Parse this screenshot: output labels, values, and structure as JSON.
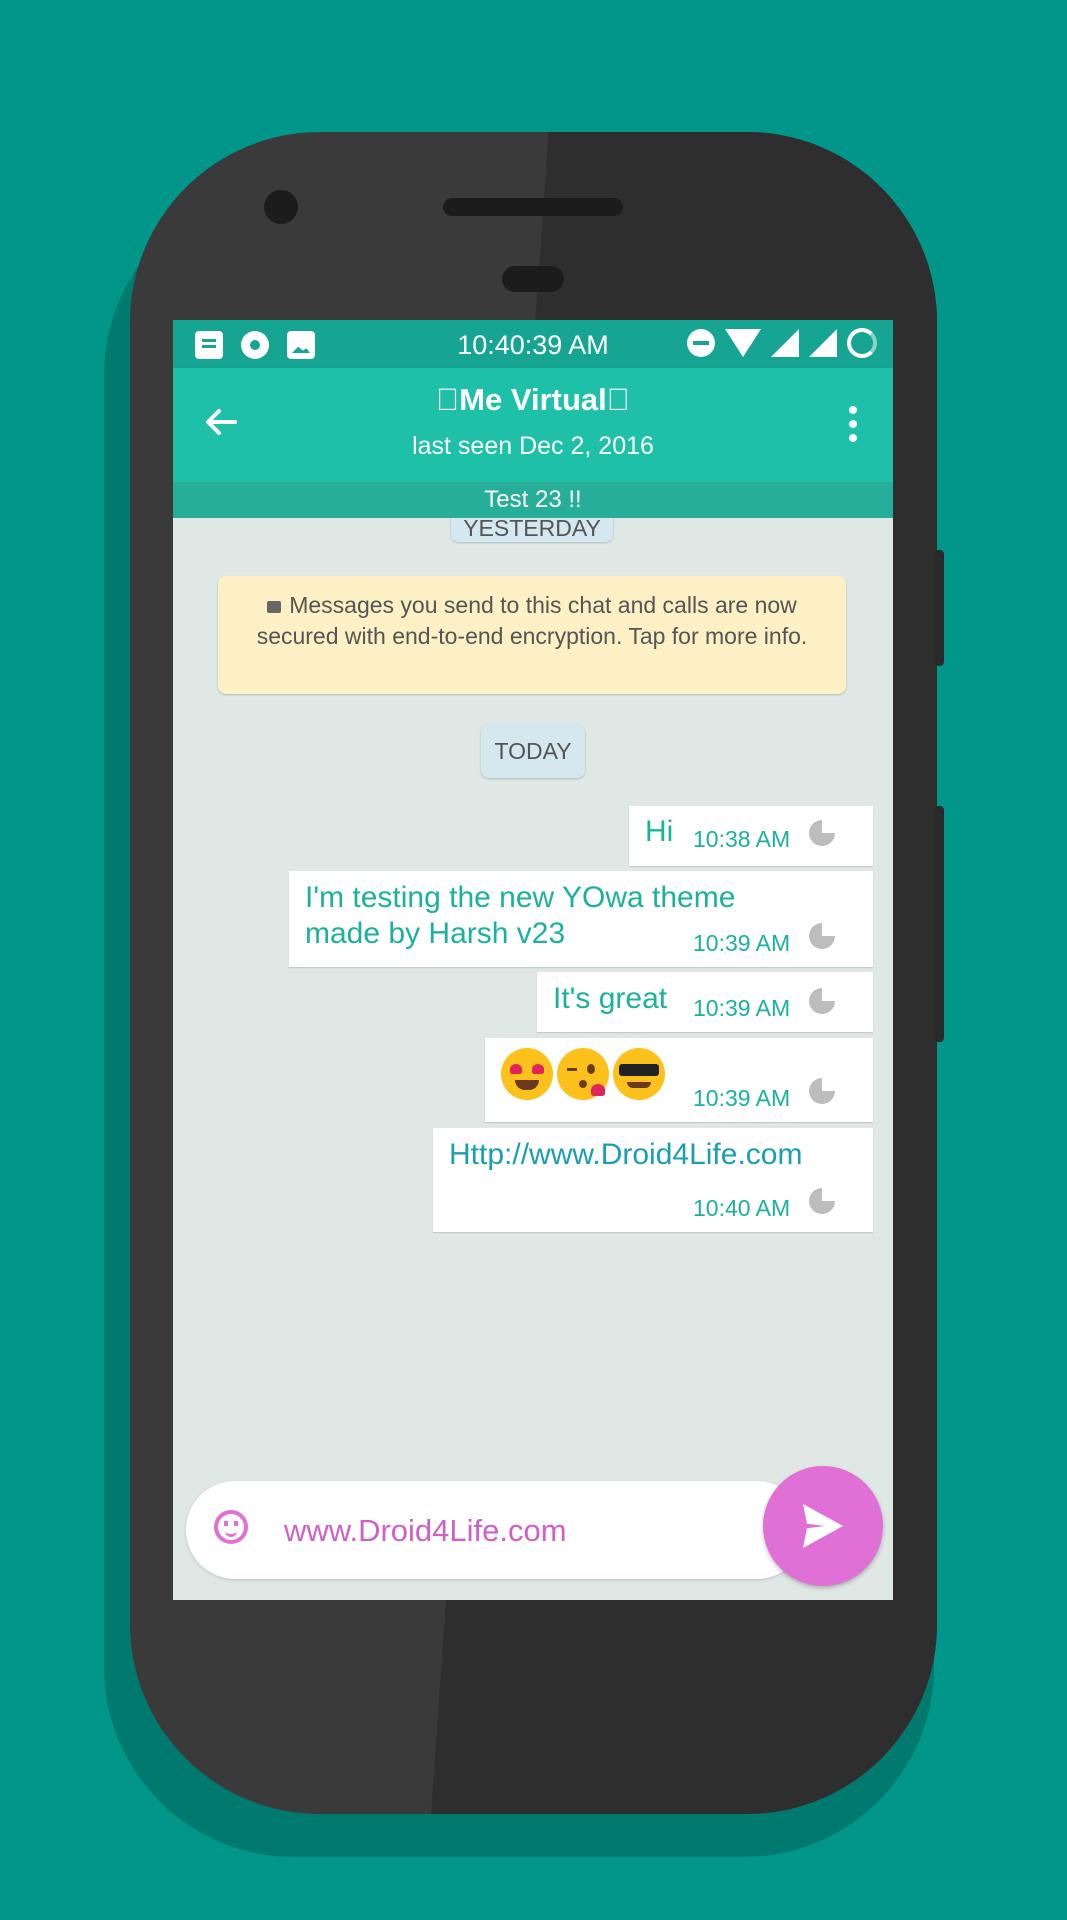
{
  "status_bar": {
    "time": "10:40:39 AM"
  },
  "app_bar": {
    "contact_name": "\u0000Me Virtual\u0000",
    "last_seen": "last seen Dec 2, 2016"
  },
  "status_strip": "Test 23 !!",
  "date_chips": {
    "yesterday": "YESTERDAY",
    "today": "TODAY"
  },
  "encryption_notice": "Messages you send to this chat and calls are now secured with end-to-end encryption. Tap for more info.",
  "messages": [
    {
      "text": "Hi",
      "time": "10:38 AM"
    },
    {
      "text": "I'm testing the new YOwa theme made by Harsh v23",
      "line1": "I'm testing the new YOwa theme",
      "line2": "made by Harsh v23",
      "time": "10:39 AM"
    },
    {
      "text": "It's great",
      "time": "10:39 AM"
    },
    {
      "emojis": [
        "heart-eyes-emoji",
        "kissing-heart-emoji",
        "sunglasses-emoji"
      ],
      "time": "10:39 AM"
    },
    {
      "text": "Http://www.Droid4Life.com",
      "time": "10:40 AM"
    }
  ],
  "composer": {
    "value": "www.Droid4Life.com"
  },
  "colors": {
    "accent": "#1ec1a8",
    "status_bar": "#16a592",
    "send": "#e070d6",
    "background": "#00968a"
  }
}
